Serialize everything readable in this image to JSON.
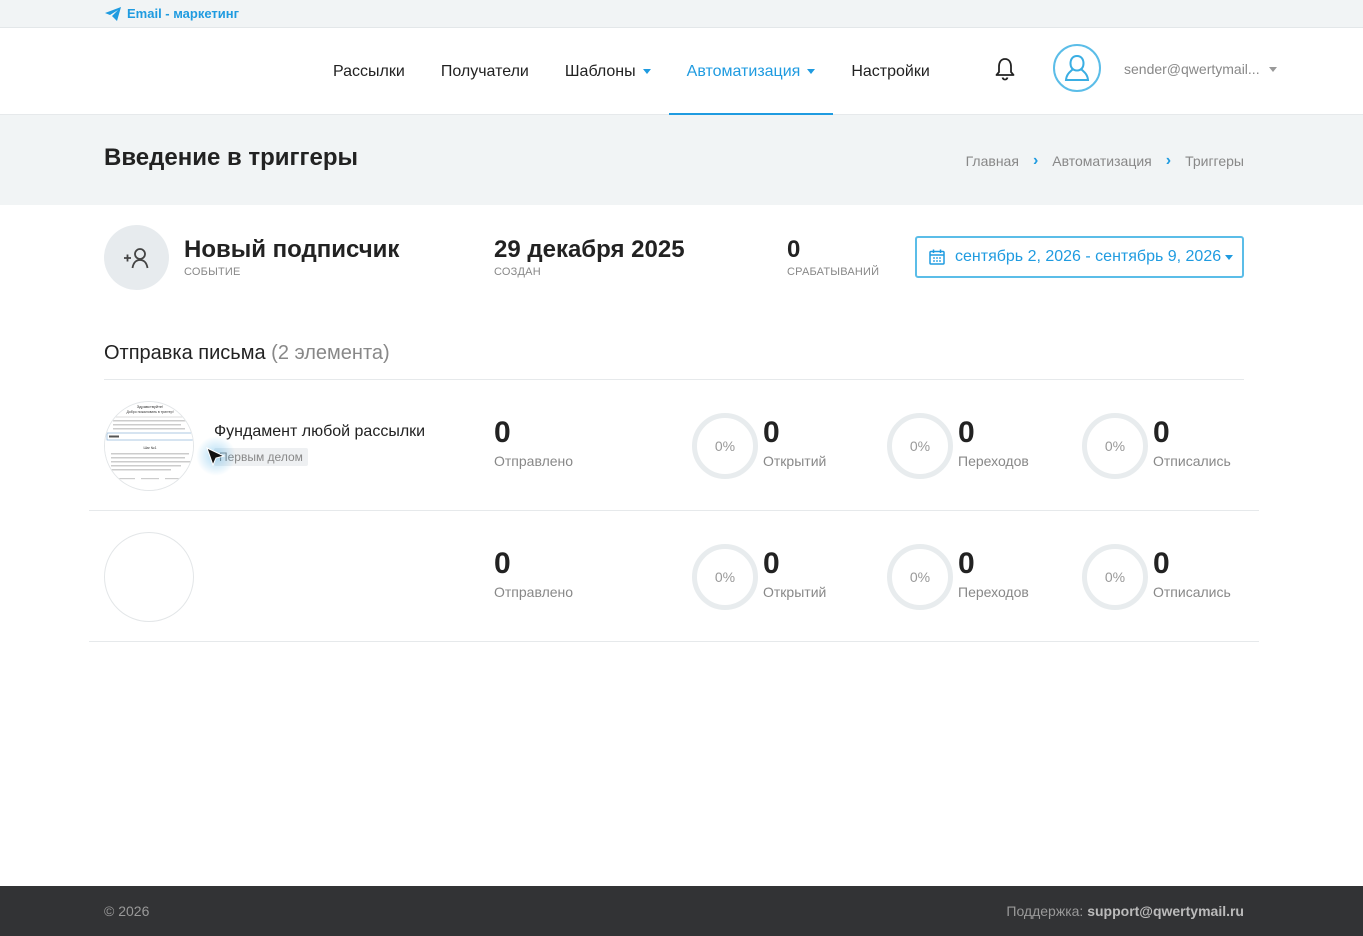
{
  "app": {
    "brand": "Email - маркетинг"
  },
  "nav": {
    "items": [
      {
        "label": "Рассылки",
        "dropdown": false,
        "active": false
      },
      {
        "label": "Получатели",
        "dropdown": false,
        "active": false
      },
      {
        "label": "Шаблоны",
        "dropdown": true,
        "active": false
      },
      {
        "label": "Автоматизация",
        "dropdown": true,
        "active": true
      },
      {
        "label": "Настройки",
        "dropdown": false,
        "active": false
      }
    ],
    "user_email": "sender@qwertymail..."
  },
  "header": {
    "title": "Введение в триггеры",
    "breadcrumb": [
      "Главная",
      "Автоматизация",
      "Триггеры"
    ]
  },
  "event": {
    "name": "Новый подписчик",
    "name_label": "СОБЫТИЕ",
    "created": "29 декабря 2025",
    "created_label": "СОЗДАН",
    "triggers": "0",
    "triggers_label": "СРАБАТЫВАНИЙ",
    "date_range": "сентябрь 2, 2026 - сентябрь 9, 2026"
  },
  "section": {
    "title": "Отправка письма",
    "count": "(2 элемента)"
  },
  "emails": [
    {
      "name": "Фундамент любой рассылки",
      "tag": "Первым делом",
      "sent": "0",
      "sent_label": "Отправлено",
      "open_pct": "0%",
      "opened": "0",
      "opened_label": "Открытий",
      "click_pct": "0%",
      "clicks": "0",
      "clicks_label": "Переходов",
      "unsub_pct": "0%",
      "unsub": "0",
      "unsub_label": "Отписались"
    },
    {
      "name": "",
      "tag": "",
      "sent": "0",
      "sent_label": "Отправлено",
      "open_pct": "0%",
      "opened": "0",
      "opened_label": "Открытий",
      "click_pct": "0%",
      "clicks": "0",
      "clicks_label": "Переходов",
      "unsub_pct": "0%",
      "unsub": "0",
      "unsub_label": "Отписались"
    }
  ],
  "thumbnail": {
    "heading": "Здравствуйте!",
    "subheading": "Добро пожаловать в триггер!",
    "step": "Шаг №1"
  },
  "footer": {
    "copyright": "© 2026",
    "support_label": "Поддержка:",
    "support_email": "support@qwertymail.ru"
  },
  "colors": {
    "accent": "#1f9be0",
    "footer_bg": "#323335",
    "header_bg": "#f1f4f5"
  }
}
